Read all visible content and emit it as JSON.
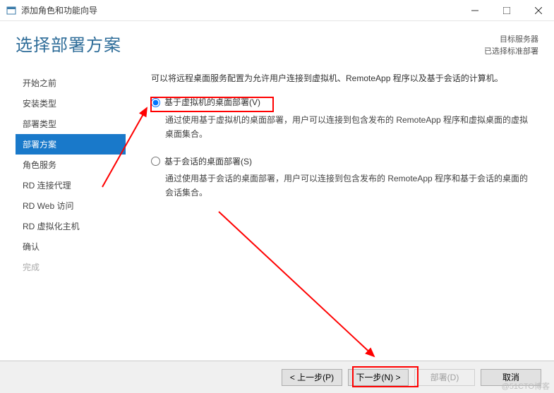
{
  "window": {
    "title": "添加角色和功能向导"
  },
  "header": {
    "page_title": "选择部署方案",
    "server_label": "目标服务器",
    "server_value": "已选择标准部署"
  },
  "sidebar": {
    "items": [
      {
        "label": "开始之前"
      },
      {
        "label": "安装类型"
      },
      {
        "label": "部署类型"
      },
      {
        "label": "部署方案"
      },
      {
        "label": "角色服务"
      },
      {
        "label": "RD 连接代理"
      },
      {
        "label": "RD Web 访问"
      },
      {
        "label": "RD 虚拟化主机"
      },
      {
        "label": "确认"
      },
      {
        "label": "完成"
      }
    ]
  },
  "content": {
    "intro": "可以将远程桌面服务配置为允许用户连接到虚拟机、RemoteApp 程序以及基于会话的计算机。",
    "option1": {
      "label": "基于虚拟机的桌面部署(V)",
      "desc": "通过使用基于虚拟机的桌面部署，用户可以连接到包含发布的 RemoteApp 程序和虚拟桌面的虚拟桌面集合。"
    },
    "option2": {
      "label": "基于会话的桌面部署(S)",
      "desc": "通过使用基于会话的桌面部署，用户可以连接到包含发布的 RemoteApp 程序和基于会话的桌面的会话集合。"
    }
  },
  "footer": {
    "previous": "< 上一步(P)",
    "next": "下一步(N) >",
    "deploy": "部署(D)",
    "cancel": "取消"
  },
  "watermark": "@51CTO博客"
}
